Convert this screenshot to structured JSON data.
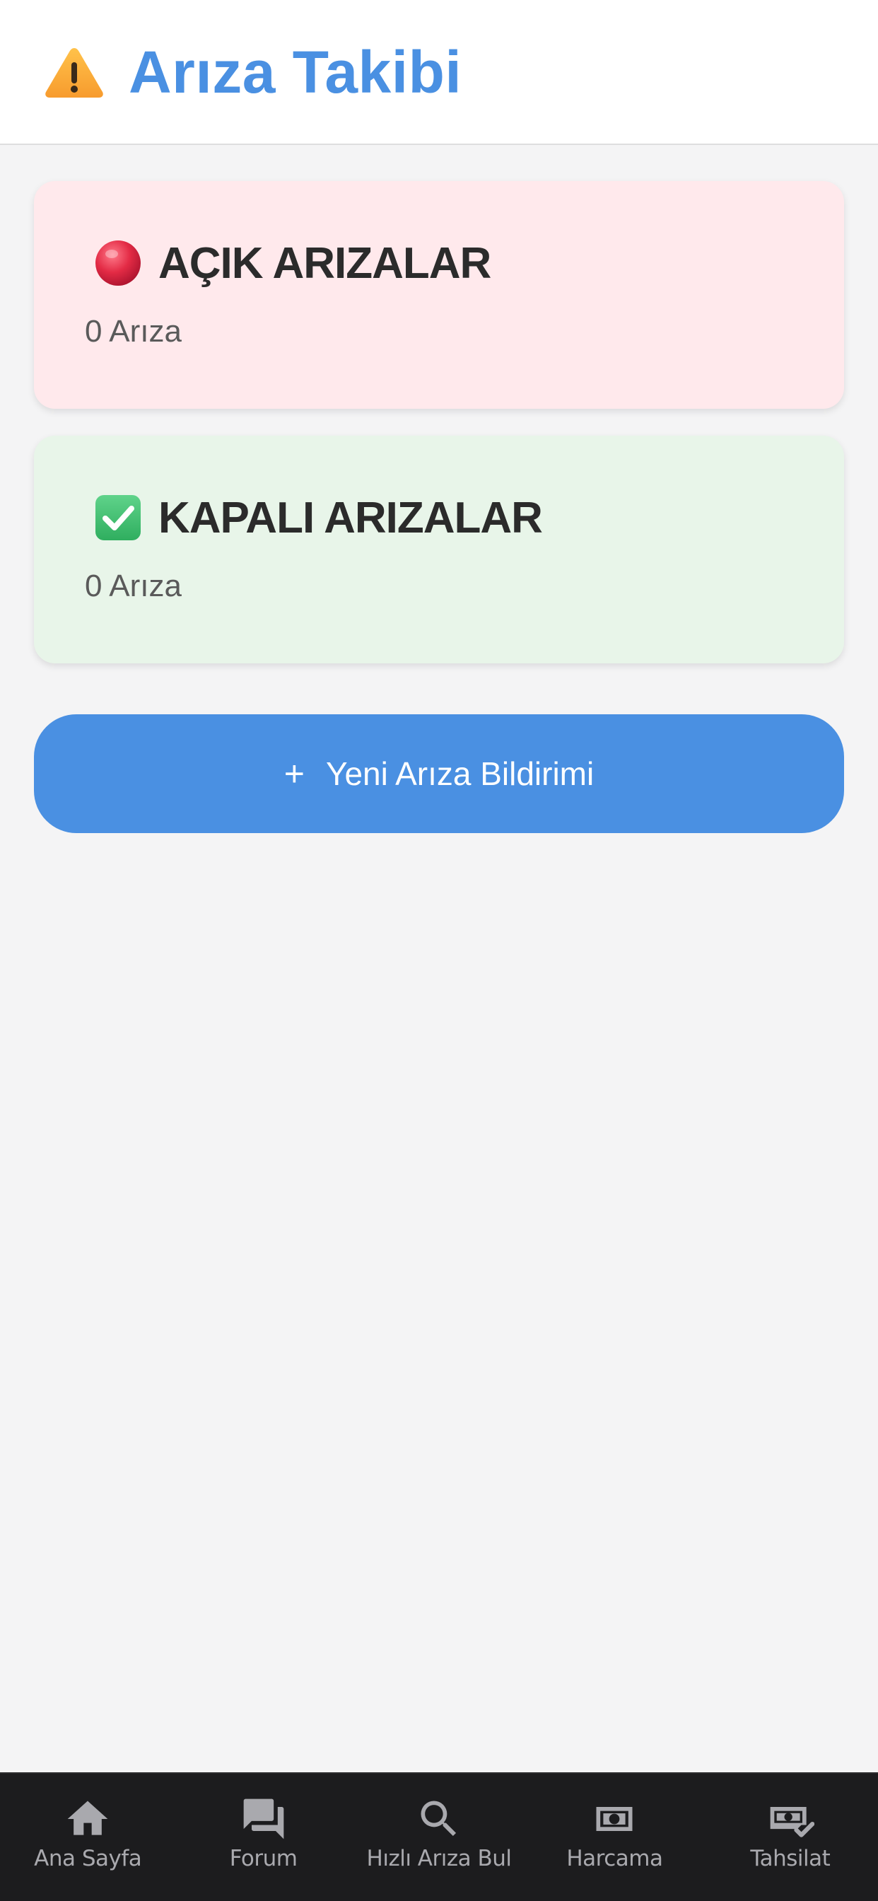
{
  "header": {
    "icon": "warning-icon",
    "title": "Arıza Takibi"
  },
  "cards": {
    "open": {
      "icon": "red-circle-icon",
      "title": "AÇIK ARIZALAR",
      "count": "0 Arıza",
      "background": "#ffe9ec"
    },
    "closed": {
      "icon": "check-box-icon",
      "title": "KAPALI ARIZALAR",
      "count": "0 Arıza",
      "background": "#e8f5e9"
    }
  },
  "new_report": {
    "icon": "plus-icon",
    "plus": "+",
    "label": "Yeni Arıza Bildirimi"
  },
  "tabs": [
    {
      "icon": "home-icon",
      "label": "Ana Sayfa"
    },
    {
      "icon": "forum-icon",
      "label": "Forum"
    },
    {
      "icon": "search-icon",
      "label": "Hızlı Arıza Bul"
    },
    {
      "icon": "cash-icon",
      "label": "Harcama"
    },
    {
      "icon": "cash-check-icon",
      "label": "Tahsilat"
    }
  ],
  "colors": {
    "accent": "#4a90e2",
    "tabbar": "#1c1c1e",
    "tab_label": "#a9a9ae",
    "background": "#f4f4f5"
  }
}
